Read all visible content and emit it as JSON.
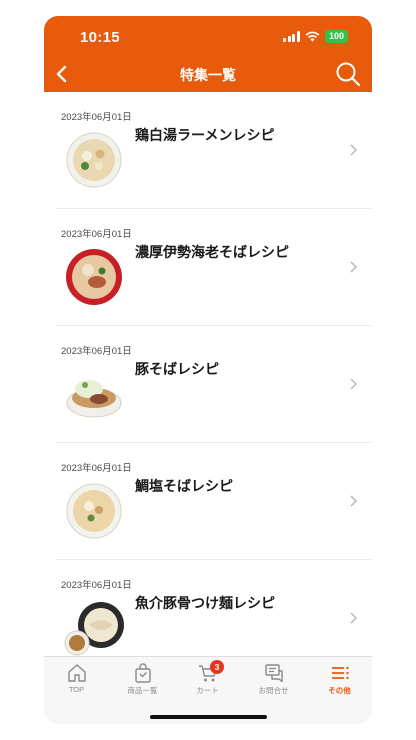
{
  "status_bar": {
    "time": "10:15",
    "battery": "100",
    "battery_color": "#30c24a"
  },
  "header": {
    "title": "特集一覧",
    "back_icon": "chevron-left-icon",
    "search_icon": "search-icon",
    "background_color": "#e95b0c"
  },
  "articles": [
    {
      "date": "2023年06月01日",
      "title": "鶏白湯ラーメンレシピ"
    },
    {
      "date": "2023年06月01日",
      "title": "濃厚伊勢海老そばレシピ"
    },
    {
      "date": "2023年06月01日",
      "title": "豚そばレシピ"
    },
    {
      "date": "2023年06月01日",
      "title": "鯛塩そばレシピ"
    },
    {
      "date": "2023年06月01日",
      "title": "魚介豚骨つけ麺レシピ"
    }
  ],
  "tab_bar": {
    "tabs": [
      {
        "label": "TOP",
        "icon": "home-icon"
      },
      {
        "label": "商品一覧",
        "icon": "shopping-bag-icon"
      },
      {
        "label": "カート",
        "icon": "cart-icon",
        "badge": "3"
      },
      {
        "label": "お問合せ",
        "icon": "chat-icon"
      },
      {
        "label": "その他",
        "icon": "menu-icon",
        "active": true
      }
    ],
    "active_color": "#e95b0c",
    "badge_color": "#e8341c"
  }
}
